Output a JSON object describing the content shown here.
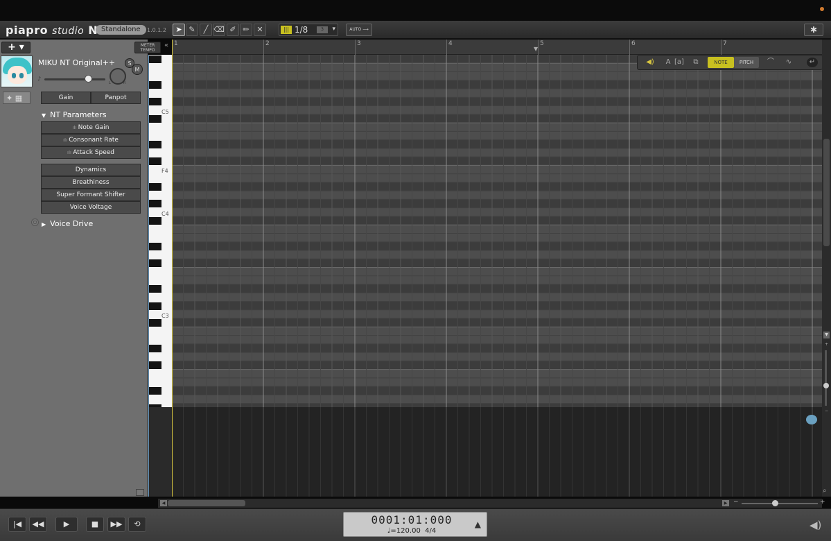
{
  "app": {
    "logo_main": "piapro",
    "logo_studio": "studio",
    "logo_nt": "NT2",
    "edition": "Standalone",
    "version": "1.0.1.2"
  },
  "toolbar": {
    "tools": [
      {
        "name": "select-tool",
        "icon": "arrow-icon",
        "glyph": "➤",
        "active": true
      },
      {
        "name": "pencil-tool",
        "icon": "pencil-icon",
        "glyph": "✎",
        "active": false
      },
      {
        "name": "line-tool",
        "icon": "line-icon",
        "glyph": "╱",
        "active": false
      },
      {
        "name": "eraser-tool",
        "icon": "eraser-icon",
        "glyph": "⌫",
        "active": false
      },
      {
        "name": "marker-tool",
        "icon": "highlighter-icon",
        "glyph": "✐",
        "active": false
      },
      {
        "name": "brush-tool",
        "icon": "brush-icon",
        "glyph": "✏",
        "active": false
      },
      {
        "name": "mute-tool",
        "icon": "close-icon",
        "glyph": "✕",
        "active": false
      }
    ],
    "quantize_value": "1/8",
    "auto_label": "AUTO ⟶",
    "settings_icon": "gear-icon"
  },
  "track": {
    "add_label": "+ ▾",
    "meter_tempo_label": "METER TEMPO",
    "collapse": "«",
    "singer_name": "MIKU NT Original++",
    "solo_label": "S",
    "mute_label": "M",
    "pan_left": "L",
    "pan_right": "R"
  },
  "params": {
    "gain_label": "Gain",
    "panpot_label": "Panpot",
    "nt_section": "NT Parameters",
    "nt_items": [
      "Note Gain",
      "Consonant Rate",
      "Attack Speed"
    ],
    "voice_items": [
      "Dynamics",
      "Breathiness",
      "Super Formant Shifter",
      "Voice Voltage"
    ],
    "voice_drive": "Voice Drive"
  },
  "keyboard": {
    "labels": [
      "C5",
      "F4",
      "C4",
      "C3"
    ]
  },
  "ruler": {
    "bars": [
      "1",
      "2",
      "3",
      "4",
      "5",
      "6",
      "7"
    ]
  },
  "floatpanel": {
    "note_label": "NOTE",
    "pitch_label": "PITCH"
  },
  "transport": {
    "time": "0001:01:000",
    "tempo": "♩=120.00",
    "signature": "4/4"
  },
  "colors": {
    "accent_yellow": "#c8c020",
    "playhead": "#d8c640",
    "cursor_blue": "#6fa0c8"
  }
}
